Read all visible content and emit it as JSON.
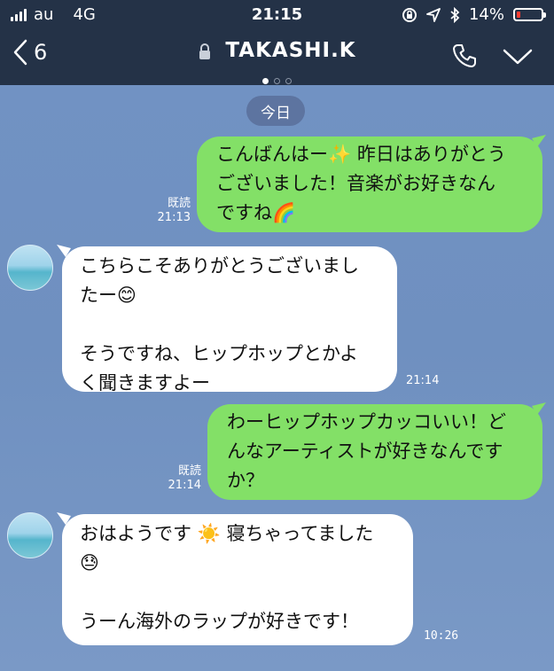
{
  "status": {
    "carrier": "au",
    "network": "4G",
    "time": "21:15",
    "battery": "14%"
  },
  "nav": {
    "back_count": "6",
    "title": "TAKASHI.K"
  },
  "chat": {
    "date_label": "今日",
    "read_label": "既読",
    "messages": [
      {
        "side": "out",
        "lines": [
          "こんばんはー✨ 昨日はありがとう",
          "ございました！音楽がお好きなん",
          "ですね🌈"
        ],
        "time": "21:13"
      },
      {
        "side": "in",
        "lines": [
          "こちらこそありがとうございまし",
          "たー😊",
          "",
          "そうですね、ヒップホップとかよ",
          "く聞きますよー"
        ],
        "time": "21:14"
      },
      {
        "side": "out",
        "lines": [
          "わーヒップホップカッコいい！ど",
          "んなアーティストが好きなんです",
          "か？"
        ],
        "time": "21:14"
      },
      {
        "side": "in",
        "lines": [
          "おはようです ☀️ 寝ちゃってました",
          "😓",
          "",
          "うーん海外のラップが好きです！"
        ],
        "time": "10:26"
      }
    ]
  },
  "colors": {
    "header_bg": "#243247",
    "chat_bg": "#7192c3",
    "outgoing_bubble": "#83e067",
    "incoming_bubble": "#ffffff",
    "battery_low": "#ff3b30"
  }
}
